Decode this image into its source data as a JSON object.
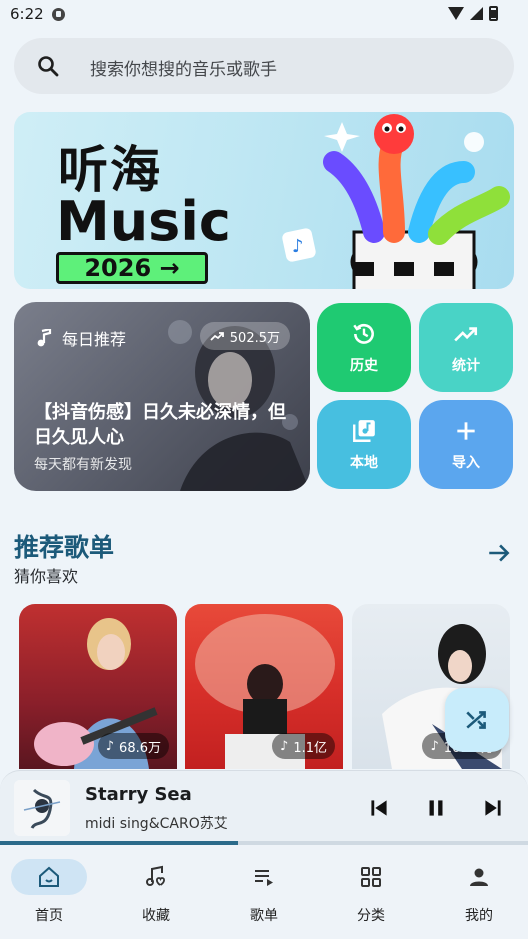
{
  "status": {
    "time": "6:22"
  },
  "search": {
    "placeholder": "搜索你想搜的音乐或歌手"
  },
  "banner": {
    "title": "听海",
    "subtitle": "Music",
    "year": "2026 →"
  },
  "daily": {
    "label": "每日推荐",
    "count": "502.5万",
    "title": "【抖音伤感】日久未必深情，但日久见人心",
    "subtitle": "每天都有新发现"
  },
  "quick": {
    "history": "历史",
    "stats": "统计",
    "local": "本地",
    "import": "导入"
  },
  "section": {
    "title": "推荐歌单",
    "subtitle": "猜你喜欢"
  },
  "playlists": [
    {
      "count": "68.6万"
    },
    {
      "count": "1.1亿"
    },
    {
      "count": "161.5万"
    }
  ],
  "player": {
    "title": "Starry Sea",
    "artist": "midi sing&CARO苏艾",
    "progress": 0.45
  },
  "nav": [
    {
      "label": "首页"
    },
    {
      "label": "收藏"
    },
    {
      "label": "歌单"
    },
    {
      "label": "分类"
    },
    {
      "label": "我的"
    }
  ],
  "colors": {
    "history": "#1fca72",
    "stats": "#49d3c6",
    "local": "#47bfe0",
    "import": "#5ba6ee",
    "accent": "#1c5a7a"
  }
}
